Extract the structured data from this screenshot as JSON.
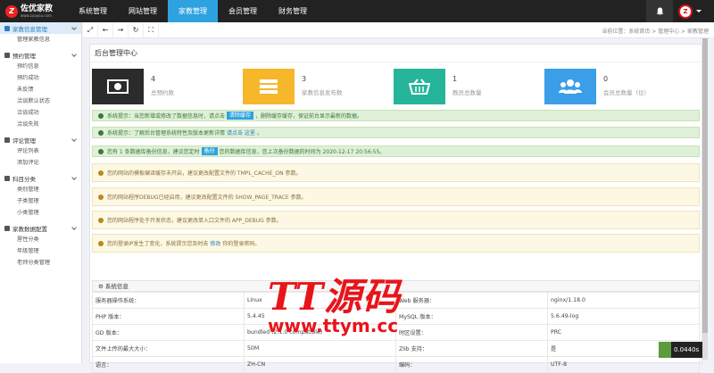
{
  "brand": {
    "name": "佐优家教",
    "sub": "www.zuoyou.com",
    "mark": "Z"
  },
  "nav": [
    {
      "label": "系统管理"
    },
    {
      "label": "网站管理"
    },
    {
      "label": "家教管理"
    },
    {
      "label": "会员管理"
    },
    {
      "label": "财务管理"
    }
  ],
  "sidebar": {
    "sections": [
      {
        "title": "家教信息管理",
        "items": [
          "管理家教信息"
        ]
      },
      {
        "title": "预约管理",
        "items": [
          "预约信息",
          "预约成功",
          "未反馈",
          "洽谈默认状态",
          "洽谈成功",
          "洽谈失败"
        ]
      },
      {
        "title": "评论管理",
        "items": [
          "评论列表",
          "添加评论"
        ]
      },
      {
        "title": "科目分类",
        "items": [
          "类别管理",
          "子类管理",
          "小类管理"
        ]
      },
      {
        "title": "家教数据配置",
        "items": [
          "屋性分类",
          "年级管理",
          "老师分类管理"
        ]
      }
    ]
  },
  "breadcrumb": "当前位置：系统首页 > 管理中心 > 家教管理",
  "panel_title": "后台管理中心",
  "stats": [
    {
      "number": "4",
      "label": "总预约数",
      "color": "#2b2b2b"
    },
    {
      "number": "3",
      "label": "家教信息发布数",
      "color": "#f6b72b"
    },
    {
      "number": "1",
      "label": "教员总数量",
      "color": "#26b59a"
    },
    {
      "number": "0",
      "label": "会员总数量（位）",
      "color": "#3a9ee8"
    }
  ],
  "alerts": {
    "a1_pre": "系统提示：当您新增或修改了数据信息时，请点击",
    "a1_btn": "清除缓存",
    "a1_post": "，删除缓存缓存，保证前台显示最新的数据。",
    "a2_pre": "系统提示：了解后台管理系统特性及版本更新详情",
    "a2_link": "请点击 这里",
    "a2_post": "。",
    "a3_pre": "您有 1 条数据库备份信息，建议您定时",
    "a3_btn": "备份",
    "a3_post": "您的数据库信息，您上次备份数据的时间为 2020-12-17 20:56:55。",
    "w1": "您的网站的模板编译缓存未开启，建议更改配置文件的 TMPL_CACHE_ON 参数。",
    "w2": "您的网站程序DEBUG已经启用，建议更改配置文件的 SHOW_PAGE_TRACE 参数。",
    "w3": "您的网站程序处于开发状态，建议更改单入口文件的 APP_DEBUG 参数。",
    "w4_pre": "您的登录IP发生了变化，系统提示您及时去",
    "w4_link": "修改",
    "w4_post": "你的登录密码。"
  },
  "sysinfo": {
    "title": "系统信息",
    "rows": [
      [
        "服务器操作系统：",
        "Linux",
        "Web 服务器：",
        "nginx/1.18.0"
      ],
      [
        "PHP 版本：",
        "5.4.45",
        "MySQL 版本：",
        "5.6.49-log"
      ],
      [
        "GD 版本：",
        "bundled (2.1.0 compatible)",
        "时区设置：",
        "PRC"
      ],
      [
        "文件上传的最大大小：",
        "50M",
        "Zlib 支持：",
        "是"
      ],
      [
        "语言：",
        "ZH-CN",
        "编码：",
        "UTF-8"
      ]
    ]
  },
  "watermark": {
    "big": "TT源码",
    "url": "www.ttym.cc"
  },
  "timer": "0.0440s",
  "colors": {
    "topbar": "#222222",
    "accent": "#2ea2e0",
    "brand_red": "#e8141a"
  }
}
